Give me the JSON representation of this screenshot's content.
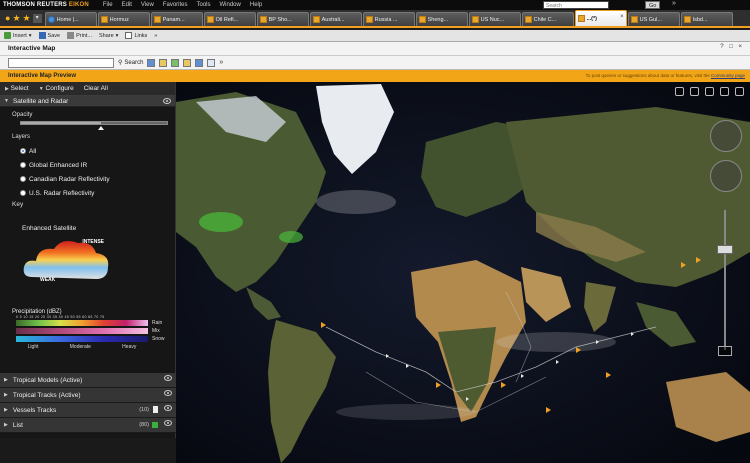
{
  "window": {
    "brand": "THOMSON REUTERS ",
    "brand_accent": "EIKON",
    "menu": [
      "File",
      "Edit",
      "View",
      "Favorites",
      "Tools",
      "Window",
      "Help"
    ],
    "search_placeholder": "Search",
    "go_label": "Go",
    "go_more": "»"
  },
  "tabs": [
    {
      "label": "Home |...",
      "icon": "globe-icon"
    },
    {
      "label": "Hormuz",
      "icon": "folder-icon"
    },
    {
      "label": "Panam...",
      "icon": "folder-icon"
    },
    {
      "label": "Oil Refi...",
      "icon": "folder-icon"
    },
    {
      "label": "BP Sho...",
      "icon": "folder-icon"
    },
    {
      "label": "Australi...",
      "icon": "folder-icon"
    },
    {
      "label": "Russia ...",
      "icon": "folder-icon"
    },
    {
      "label": "Sheng...",
      "icon": "folder-icon"
    },
    {
      "label": "US Nuc...",
      "icon": "folder-icon"
    },
    {
      "label": "Chile C...",
      "icon": "folder-icon"
    },
    {
      "label": "...(*)",
      "icon": "folder-icon",
      "active": true
    },
    {
      "label": "US Gul...",
      "icon": "folder-icon"
    },
    {
      "label": "Isbd...",
      "icon": "folder-icon"
    }
  ],
  "toolbar": {
    "insert": "Insert",
    "save": "Save",
    "print": "Print...",
    "share": "Share",
    "links": "Links",
    "more": "»"
  },
  "app": {
    "title": "Interactive Map",
    "window_buttons": "? □ ×",
    "search_button": "Search",
    "more": "»",
    "preview_title": "Interactive Map Preview",
    "notice": "To post queries or suggestions about data or features, visit the ",
    "notice_link": "Community page"
  },
  "panel": {
    "select": "Select",
    "configure": "Configure",
    "clear_all": "Clear All",
    "section_title": "Satellite and Radar",
    "opacity_label": "Opacity",
    "opacity_value": 0.55,
    "layers_label": "Layers",
    "layers": [
      {
        "label": "All",
        "selected": true
      },
      {
        "label": "Global Enhanced IR",
        "selected": false
      },
      {
        "label": "Canadian Radar Reflectivity",
        "selected": false
      },
      {
        "label": "U.S. Radar Reflectivity",
        "selected": false
      }
    ],
    "key_label": "Key",
    "sat_key_title": "Enhanced Satellite",
    "sat_strong": "INTENSE",
    "sat_weak": "WEAK",
    "precip_title": "Precipitation (dBZ)",
    "precip_ticks": "0  5  10  15  20  25  30  35  40  45  50  55  60  65  70  75",
    "precip_rain": "Rain",
    "precip_mix": "Mix",
    "precip_snow": "Snow",
    "precip_light": "Light",
    "precip_moderate": "Moderate",
    "precip_heavy": "Heavy",
    "accordions": [
      {
        "label": "Tropical Models (Active)",
        "count": "",
        "extra": "eye"
      },
      {
        "label": "Tropical Tracks (Active)",
        "count": "",
        "extra": "eye"
      },
      {
        "label": "Vessels Tracks",
        "count": "(10)",
        "extra": "pin"
      },
      {
        "label": "List",
        "count": "(80)",
        "extra": "green"
      }
    ]
  },
  "colors": {
    "accent": "#f2a617",
    "panel_bg": "#161616",
    "section_bg": "#3a3a3a"
  }
}
